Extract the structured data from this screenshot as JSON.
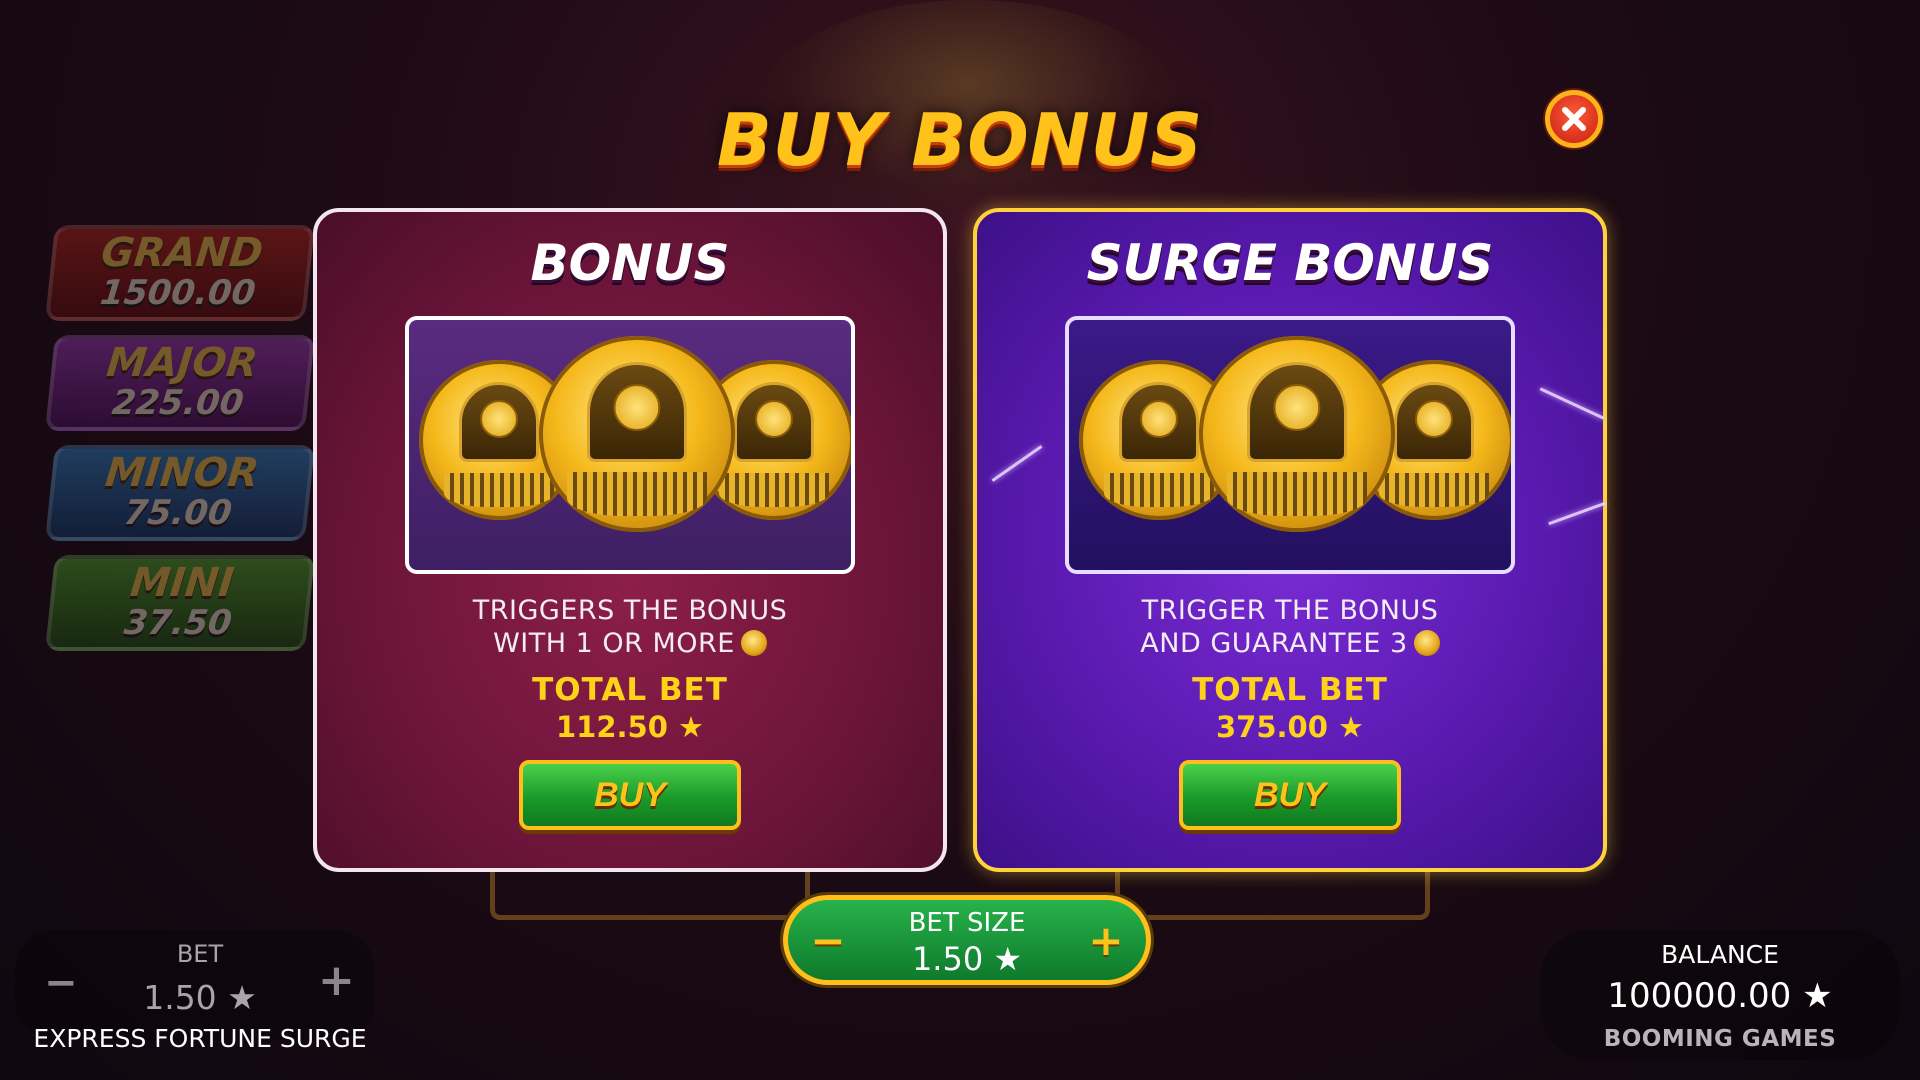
{
  "title": "BUY BONUS",
  "close_icon": "close-x-icon",
  "jackpots": [
    {
      "name": "GRAND",
      "value": "1500.00"
    },
    {
      "name": "MAJOR",
      "value": "225.00"
    },
    {
      "name": "MINOR",
      "value": "75.00"
    },
    {
      "name": "MINI",
      "value": "37.50"
    }
  ],
  "cards": {
    "bonus": {
      "title": "BONUS",
      "desc_line1": "TRIGGERS THE BONUS",
      "desc_line2": "WITH 1 OR MORE",
      "total_bet_label": "TOTAL BET",
      "total_bet_value": "112.50",
      "buy_label": "BUY"
    },
    "surge": {
      "title": "SURGE BONUS",
      "desc_line1": "TRIGGER THE BONUS",
      "desc_line2": "AND GUARANTEE 3",
      "total_bet_label": "TOTAL BET",
      "total_bet_value": "375.00",
      "buy_label": "BUY"
    }
  },
  "bet_size": {
    "label": "BET SIZE",
    "value": "1.50",
    "minus": "−",
    "plus": "+"
  },
  "bottom": {
    "bet_label": "BET",
    "bet_value": "1.50",
    "bet_minus": "−",
    "bet_plus": "+",
    "game_name": "EXPRESS FORTUNE SURGE",
    "balance_label": "BALANCE",
    "balance_value": "100000.00",
    "brand": "BOOMING GAMES"
  },
  "star": "★",
  "colors": {
    "gold": "#ffc21a",
    "bonus_card": "#6e153a",
    "surge_card": "#5a1ab0",
    "buy_green": "#1a9a2a"
  }
}
